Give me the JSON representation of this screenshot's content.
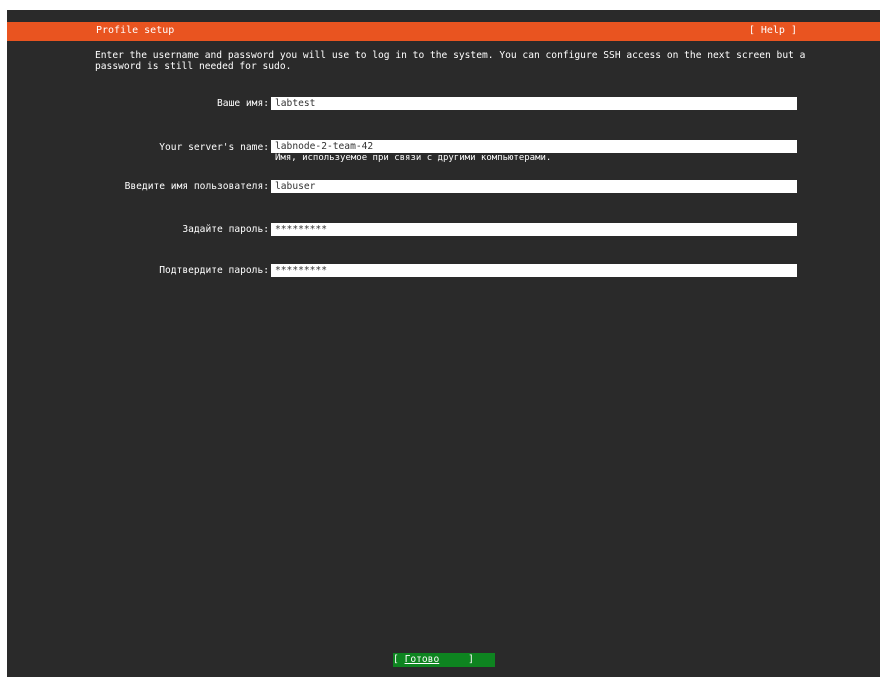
{
  "header": {
    "title": "Profile setup",
    "help_label": "[ Help ]"
  },
  "intro_text": "Enter the username and password you will use to log in to the system. You can configure SSH access on the next screen but a password is still needed for sudo.",
  "form": {
    "name": {
      "label": "Ваше имя:",
      "value": "labtest"
    },
    "server_name": {
      "label": "Your server's name:",
      "value": "labnode-2-team-42",
      "hint": "Имя, используемое при связи с другими компьютерами."
    },
    "username": {
      "label": "Введите имя пользователя:",
      "value": "labuser"
    },
    "password": {
      "label": "Задайте пароль:",
      "value": "*********"
    },
    "confirm_password": {
      "label": "Подтвердите пароль:",
      "value": "*********"
    }
  },
  "footer": {
    "done_open": "[ ",
    "done_label": "Готово",
    "done_close": "     ]"
  },
  "colors": {
    "header_bg": "#e95420",
    "screen_bg": "#2a2a2a",
    "button_bg": "#0e8420"
  }
}
